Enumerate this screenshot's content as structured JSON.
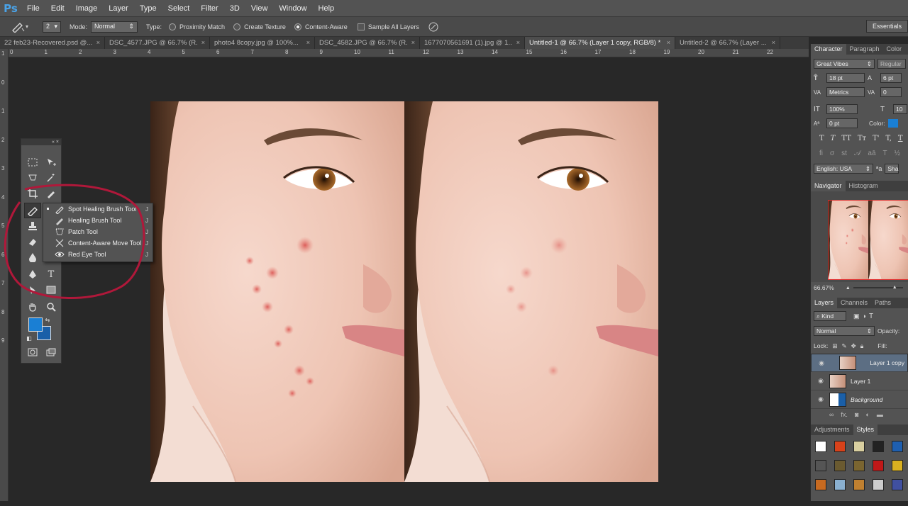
{
  "app": {
    "logo": "Ps"
  },
  "menu": [
    "File",
    "Edit",
    "Image",
    "Layer",
    "Type",
    "Select",
    "Filter",
    "3D",
    "View",
    "Window",
    "Help"
  ],
  "options": {
    "size": "2",
    "mode_label": "Mode:",
    "mode_value": "Normal",
    "type_label": "Type:",
    "proximity": "Proximity Match",
    "create_texture": "Create Texture",
    "content_aware": "Content-Aware",
    "sample_all": "Sample All Layers",
    "workspace": "Essentials"
  },
  "tabs": [
    {
      "label": "22 feb23-Recovered.psd @..."
    },
    {
      "label": "DSC_4577.JPG @ 66.7% (R..."
    },
    {
      "label": "photo4 8copy.jpg @ 100%..."
    },
    {
      "label": "DSC_4582.JPG @ 66.7% (R..."
    },
    {
      "label": "1677070561691 (1).jpg @ 1..."
    },
    {
      "label": "Untitled-1 @ 66.7% (Layer 1 copy, RGB/8) *"
    },
    {
      "label": "Untitled-2 @ 66.7% (Layer ..."
    }
  ],
  "ruler_top": [
    "0",
    "1",
    "2",
    "3",
    "4",
    "5",
    "6",
    "7",
    "8",
    "9",
    "10",
    "11",
    "12",
    "13",
    "14",
    "15",
    "16",
    "17",
    "18",
    "19",
    "20",
    "21",
    "22"
  ],
  "ruler_left": [
    "1",
    "0",
    "1",
    "2",
    "3",
    "4",
    "5",
    "6",
    "7",
    "8",
    "9"
  ],
  "flyout": [
    {
      "label": "Spot Healing Brush Tool",
      "key": "J",
      "active": true
    },
    {
      "label": "Healing Brush Tool",
      "key": "J",
      "active": false
    },
    {
      "label": "Patch Tool",
      "key": "J",
      "active": false
    },
    {
      "label": "Content-Aware Move Tool",
      "key": "J",
      "active": false
    },
    {
      "label": "Red Eye Tool",
      "key": "J",
      "active": false
    }
  ],
  "colors": {
    "foreground": "#1a7fd4",
    "background": "#1a5fa8",
    "annotation": "#b0183a"
  },
  "character": {
    "tabs": [
      "Character",
      "Paragraph",
      "Color",
      "Sw"
    ],
    "font": "Great Vibes",
    "style": "Regular",
    "size": "18 pt",
    "leading": "6 pt",
    "kerning": "Metrics",
    "tracking": "0",
    "v_scale": "100%",
    "h_scale": "10",
    "baseline": "0 pt",
    "color_label": "Color:",
    "lang": "English: USA",
    "aa": "Sha"
  },
  "navigator": {
    "tabs": [
      "Navigator",
      "Histogram"
    ],
    "zoom": "66.67%"
  },
  "layers_panel": {
    "tabs": [
      "Layers",
      "Channels",
      "Paths"
    ],
    "kind": "Kind",
    "blend": "Normal",
    "opacity_label": "Opacity:",
    "lock_label": "Lock:",
    "fill_label": "Fill:",
    "layers": [
      {
        "name": "Layer 1 copy",
        "selected": true
      },
      {
        "name": "Layer 1",
        "selected": false
      },
      {
        "name": "Background",
        "selected": false
      }
    ]
  },
  "styles_panel": {
    "tabs": [
      "Adjustments",
      "Styles"
    ]
  }
}
